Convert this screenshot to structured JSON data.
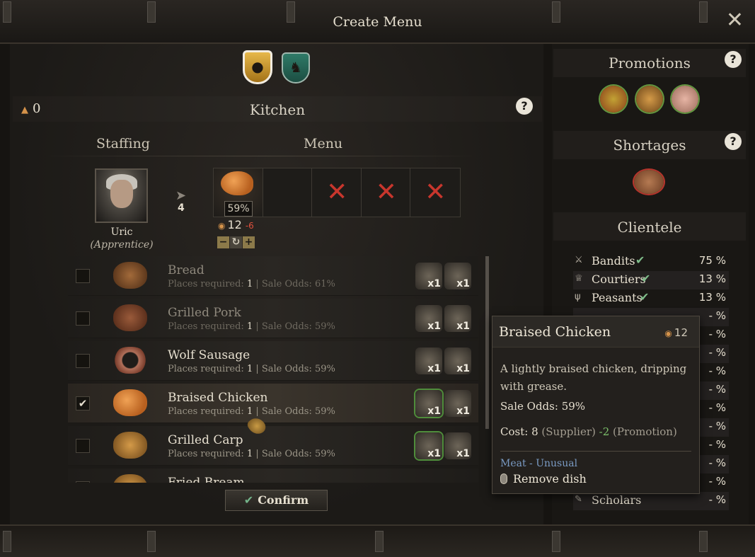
{
  "window": {
    "title": "Create Menu",
    "close_glyph": "✕"
  },
  "kitchen": {
    "title": "Kitchen",
    "gold": "0",
    "gold_icon": "coins-icon",
    "help": "?"
  },
  "columns": {
    "staffing": "Staffing",
    "menu": "Menu"
  },
  "staff": {
    "name": "Uric",
    "role": "(Apprentice)",
    "capacity": "4"
  },
  "menu_slot": {
    "odds": "59%",
    "price": "12",
    "price_mod": "-6"
  },
  "stepper": {
    "minus": "−",
    "reset": "↻",
    "plus": "+"
  },
  "recipes": [
    {
      "name": "Bread",
      "places_label": "Places required: ",
      "places": "1",
      "odds_label": " | Sale Odds: ",
      "odds": "61%",
      "checked": false,
      "dim": true,
      "ing": [
        "x1",
        "x1"
      ]
    },
    {
      "name": "Grilled Pork",
      "places_label": "Places required: ",
      "places": "1",
      "odds_label": " | Sale Odds: ",
      "odds": "59%",
      "checked": false,
      "dim": true,
      "ing": [
        "x1",
        "x1"
      ]
    },
    {
      "name": "Wolf Sausage",
      "places_label": "Places required: ",
      "places": "1",
      "odds_label": " | Sale Odds: ",
      "odds": "59%",
      "checked": false,
      "dim": false,
      "ing": [
        "x1",
        "x1"
      ]
    },
    {
      "name": "Braised Chicken",
      "places_label": "Places required: ",
      "places": "1",
      "odds_label": " | Sale Odds: ",
      "odds": "59%",
      "checked": true,
      "dim": false,
      "ing": [
        "x1",
        "x1"
      ]
    },
    {
      "name": "Grilled Carp",
      "places_label": "Places required: ",
      "places": "1",
      "odds_label": " | Sale Odds: ",
      "odds": "59%",
      "checked": false,
      "dim": false,
      "ing": [
        "x1",
        "x1"
      ]
    },
    {
      "name": "Fried Bream",
      "places_label": "",
      "places": "",
      "odds_label": "",
      "odds": "",
      "checked": false,
      "dim": false,
      "ing": [
        "",
        ""
      ]
    }
  ],
  "confirm": {
    "label": "Confirm",
    "check": "✔"
  },
  "promotions": {
    "title": "Promotions",
    "help": "?",
    "items": [
      "apples-icon",
      "fish-icon",
      "chicken-icon"
    ]
  },
  "shortages": {
    "title": "Shortages",
    "help": "?",
    "items": [
      "mushroom-icon"
    ]
  },
  "clientele": {
    "title": "Clientele",
    "rows": [
      {
        "name": "Bandits",
        "ok": "✔",
        "pct": "75 %"
      },
      {
        "name": "Courtiers",
        "ok": "✔",
        "pct": "13 %"
      },
      {
        "name": "Peasants",
        "ok": "✔",
        "pct": "13 %"
      },
      {
        "name": "",
        "ok": "",
        "pct": "- %"
      },
      {
        "name": "",
        "ok": "",
        "pct": "- %"
      },
      {
        "name": "",
        "ok": "",
        "pct": "- %"
      },
      {
        "name": "",
        "ok": "",
        "pct": "- %"
      },
      {
        "name": "",
        "ok": "",
        "pct": "- %"
      },
      {
        "name": "",
        "ok": "",
        "pct": "- %"
      },
      {
        "name": "",
        "ok": "",
        "pct": "- %"
      },
      {
        "name": "",
        "ok": "",
        "pct": "- %"
      },
      {
        "name": "",
        "ok": "",
        "pct": "- %"
      },
      {
        "name": "",
        "ok": "",
        "pct": "- %"
      },
      {
        "name": "Scholars",
        "ok": "",
        "pct": "- %"
      }
    ]
  },
  "tooltip": {
    "title": "Braised Chicken",
    "price": "12",
    "description": "A lightly braised chicken, dripping with grease.",
    "odds_label": "Sale Odds: ",
    "odds": "59%",
    "cost_label": "Cost: ",
    "cost": "8",
    "cost_source": " (Supplier) ",
    "promo": "-2",
    "promo_source": " (Promotion)",
    "tag": "Meat - Unusual",
    "action": "Remove dish"
  },
  "colors": {
    "accent_green": "#7fbd8a",
    "negative_red": "#e0503d",
    "tag_blue": "#7a9bc4",
    "shield_gold": "#e7b84a",
    "shield_teal": "#2f7a67"
  }
}
